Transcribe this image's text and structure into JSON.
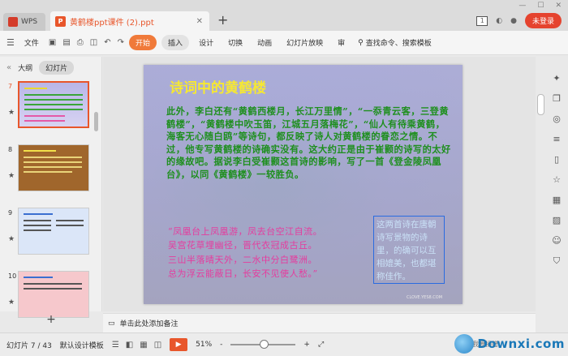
{
  "titlebar": {
    "app_tab": "WPS",
    "doc_tab": "黄鹤楼ppt课件 (2).ppt",
    "new_tab": "+",
    "badge": "1",
    "login": "未登录"
  },
  "ribbon": {
    "file": "文件",
    "tabs": [
      "开始",
      "插入",
      "设计",
      "切换",
      "动画",
      "幻灯片放映",
      "审"
    ],
    "search": "查找命令、搜索模板"
  },
  "leftpanel": {
    "tab_outline": "大纲",
    "tab_slides": "幻灯片",
    "thumbs": [
      {
        "num": "7",
        "star": "★"
      },
      {
        "num": "8",
        "star": "★"
      },
      {
        "num": "9",
        "star": "★"
      },
      {
        "num": "10",
        "star": "★"
      }
    ],
    "add": "+"
  },
  "slide": {
    "title": "诗词中的黄鹤楼",
    "body": "此外，李白还有“黄鹤西楼月，长江万里情”，“一忝青云客，三登黄鹤楼”，“黄鹤楼中吹玉笛，江城五月落梅花”，“仙人有待乘黄鹤，海客无心随白鸥”等诗句，都反映了诗人对黄鹤楼的眷恋之情。不过，他专写黄鹤楼的诗确实没有。这大约正是由于崔颢的诗写的太好的缘故吧。据说李白受崔颢这首诗的影响，写了一首《登金陵凤凰台》，以同《黄鹤楼》一较胜负。",
    "poem_lines": [
      "“凤凰台上凤凰游，凤去台空江自流。",
      "吴宫花草埋幽径，晋代衣冠成古丘。",
      "三山半落晴天外，二水中分白鹭洲。",
      "总为浮云能蔽日，长安不见使人愁。”"
    ],
    "note": "这两首诗在唐朝诗写景物的诗里，的确可以互相媲美，也都堪称佳作。",
    "watermark": "CLOVE.YES8.COM"
  },
  "notes": {
    "placeholder": "单击此处添加备注"
  },
  "status": {
    "slide_count": "幻灯片 7 / 43",
    "template": "默认设计模板",
    "zoom": "51%",
    "zoom_minus": "-",
    "zoom_plus": "+",
    "zoom_fraction": 0.51,
    "activate": "我要捐赠",
    "watermark": "Downxi.com"
  }
}
